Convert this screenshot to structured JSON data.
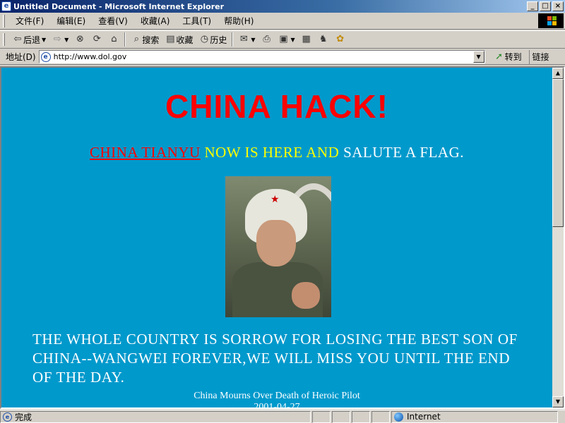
{
  "window": {
    "title": "Untitled Document - Microsoft Internet Explorer",
    "controls": [
      "_",
      "□",
      "×"
    ]
  },
  "menu": {
    "items": [
      "文件(F)",
      "编辑(E)",
      "查看(V)",
      "收藏(A)",
      "工具(T)",
      "帮助(H)"
    ]
  },
  "toolbar": {
    "back_label": "后退",
    "search_label": "搜索",
    "favorites_label": "收藏",
    "history_label": "历史"
  },
  "address": {
    "label": "地址(D)",
    "url": "http://www.dol.gov",
    "go_label": "转到",
    "links_label": "链接"
  },
  "page": {
    "background": "#0099cc",
    "headline": "CHINA HACK!",
    "tagline": {
      "part1": "CHINA TIANYU",
      "part2": "NOW IS HERE AND",
      "part3": "SALUTE A FLAG."
    },
    "photo_icon": "pilot-photo",
    "tribute": "THE WHOLE COUNTRY IS SORROW FOR LOSING THE BEST SON OF CHINA--WANGWEI FOREVER,WE WILL MISS YOU UNTIL THE END OF THE DAY.",
    "caption_line1": "China Mourns Over Death of Heroic Pilot",
    "caption_line2": "2001-04-27"
  },
  "status": {
    "text": "完成",
    "zone": "Internet"
  },
  "colors": {
    "headline": "#ff0000",
    "tagline_red": "#ff0000",
    "tagline_yellow": "#ffff00",
    "tagline_white": "#ffffff"
  }
}
